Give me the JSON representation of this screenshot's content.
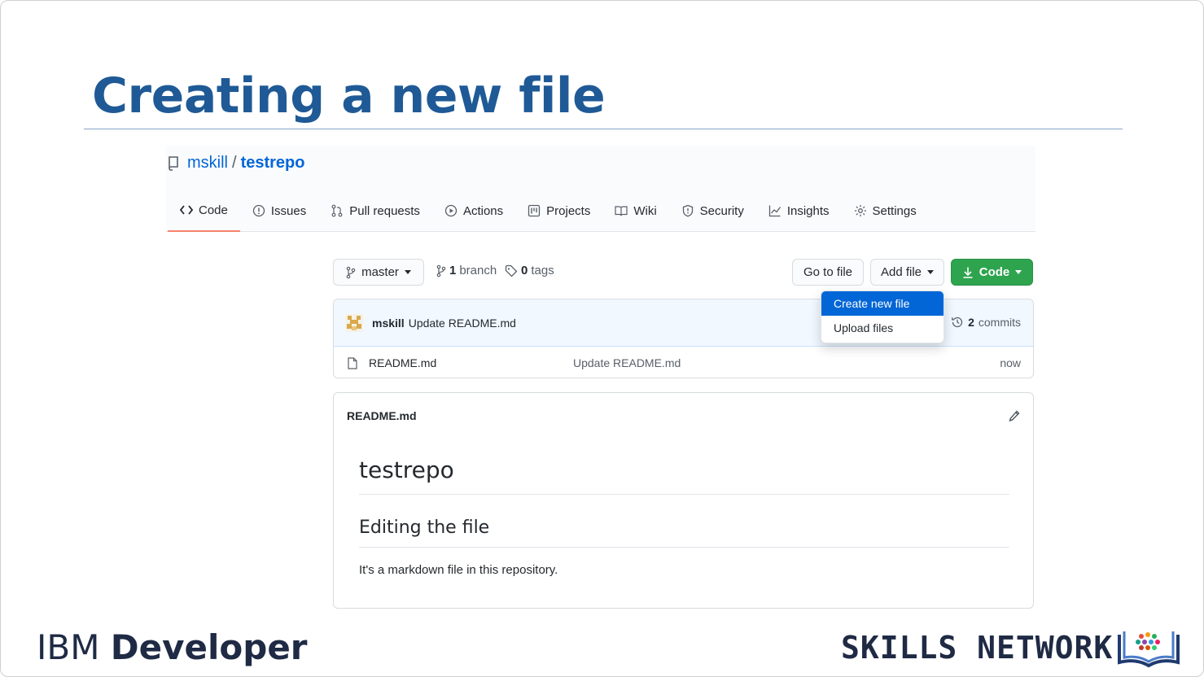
{
  "slide": {
    "title": "Creating a new file"
  },
  "repo": {
    "owner": "mskill",
    "separator": "/",
    "name": "testrepo"
  },
  "tabs": [
    {
      "label": "Code",
      "icon": "code-icon",
      "active": true
    },
    {
      "label": "Issues",
      "icon": "issue-icon"
    },
    {
      "label": "Pull requests",
      "icon": "pull-request-icon"
    },
    {
      "label": "Actions",
      "icon": "play-icon"
    },
    {
      "label": "Projects",
      "icon": "project-icon"
    },
    {
      "label": "Wiki",
      "icon": "book-icon"
    },
    {
      "label": "Security",
      "icon": "shield-icon"
    },
    {
      "label": "Insights",
      "icon": "graph-icon"
    },
    {
      "label": "Settings",
      "icon": "gear-icon"
    }
  ],
  "toolbar": {
    "branch_select": "master",
    "branch_count": "1",
    "branch_label": "branch",
    "tag_count": "0",
    "tag_label": "tags",
    "go_to_file": "Go to file",
    "add_file": "Add file",
    "code": "Code"
  },
  "dropdown": {
    "items": [
      {
        "label": "Create new file",
        "active": true
      },
      {
        "label": "Upload files"
      }
    ]
  },
  "latest_commit": {
    "author": "mskill",
    "message": "Update README.md",
    "commits_count": "2",
    "commits_label": "commits"
  },
  "files": [
    {
      "name": "README.md",
      "message": "Update README.md",
      "age": "now"
    }
  ],
  "readme": {
    "filename": "README.md",
    "h1": "testrepo",
    "h2": "Editing the file",
    "paragraph": "It's a markdown file in this repository."
  },
  "branding": {
    "ibm_prefix": "IBM",
    "ibm_suffix": "Developer",
    "skills": "SKILLS NETWORK"
  },
  "colors": {
    "title": "#1f5a96",
    "link": "#0366d6",
    "green": "#2ea44f",
    "tab_underline": "#f9826c"
  }
}
